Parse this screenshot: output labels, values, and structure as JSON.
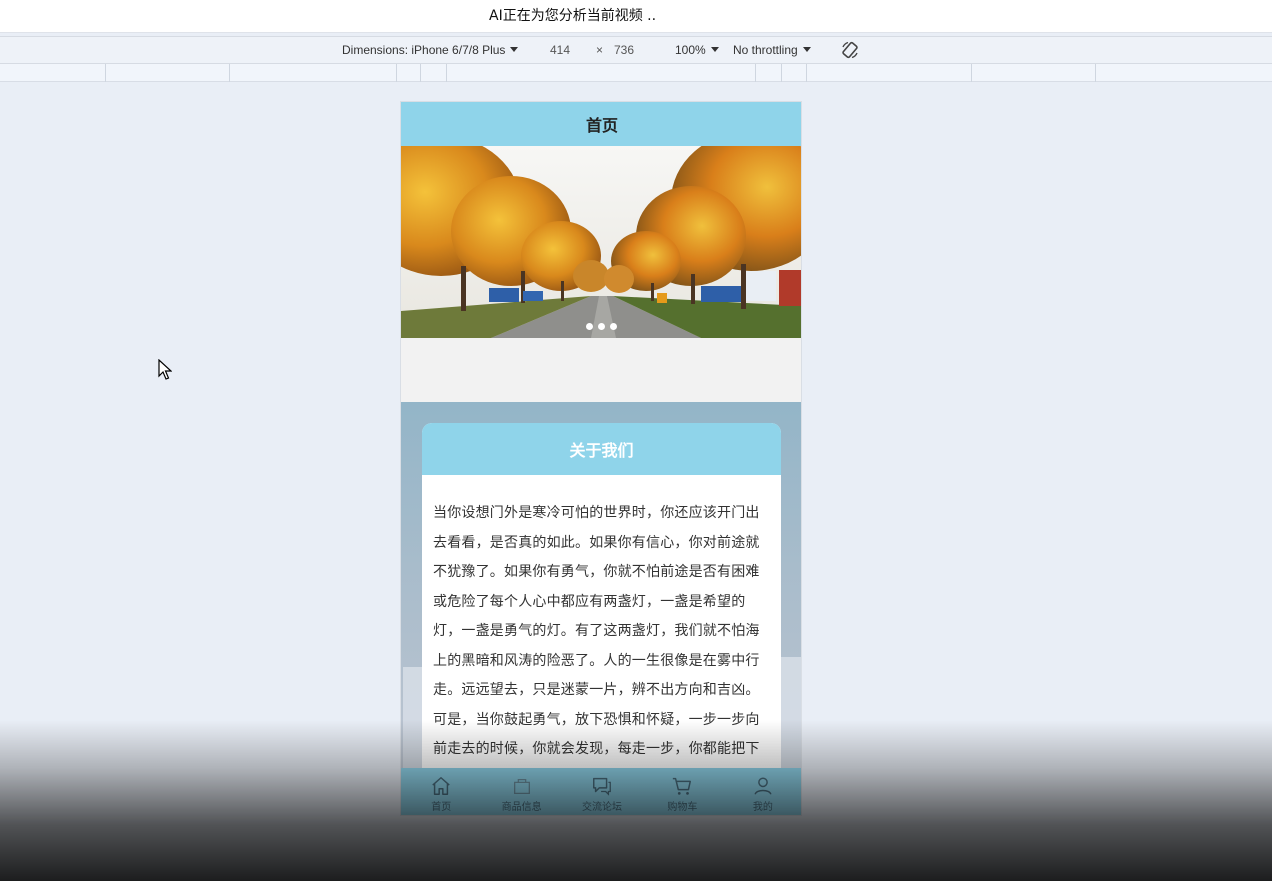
{
  "caption": {
    "text": "AI正在为您分析当前视频 .."
  },
  "devtools": {
    "dimensions_label": "Dimensions: iPhone 6/7/8 Plus",
    "width": "414",
    "times": "×",
    "height": "736",
    "zoom": "100%",
    "throttling": "No throttling",
    "rotate_icon": "rotate-icon"
  },
  "phone": {
    "title": "首页",
    "banner": {
      "slides": 3,
      "active_slide": 1
    },
    "about": {
      "title": "关于我们",
      "body": "当你设想门外是寒冷可怕的世界时，你还应该开门出去看看，是否真的如此。如果你有信心，你对前途就不犹豫了。如果你有勇气，你就不怕前途是否有困难或危险了每个人心中都应有两盏灯，一盏是希望的灯，一盏是勇气的灯。有了这两盏灯，我们就不怕海上的黑暗和风涛的险恶了。人的一生很像是在雾中行走。远远望去，只是迷蒙一片，辨不出方向和吉凶。可是，当你鼓起勇气，放下恐惧和怀疑，一步一步向前走去的时候，你就会发现，每走一步，你都能把下一步路看得清楚一点。往前走，别站在远远的地方观望"
    },
    "tabs": [
      {
        "label": "首页",
        "icon": "home-icon"
      },
      {
        "label": "商品信息",
        "icon": "goods-icon"
      },
      {
        "label": "交流论坛",
        "icon": "forum-icon"
      },
      {
        "label": "购物车",
        "icon": "cart-icon"
      },
      {
        "label": "我的",
        "icon": "user-icon"
      }
    ]
  },
  "colors": {
    "header": "#8fd4ea",
    "page_bg": "#e9eef6"
  }
}
